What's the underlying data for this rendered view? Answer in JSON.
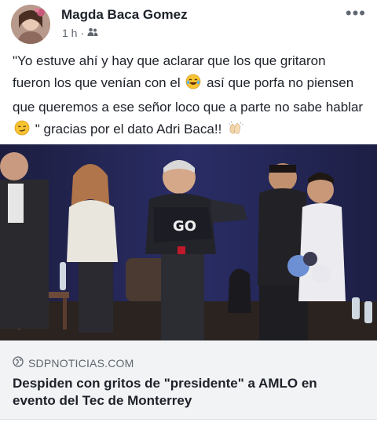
{
  "post": {
    "author": "Magda Baca Gomez",
    "time": "1 h",
    "separator": "·",
    "audience_icon": "friends-icon",
    "more_label": "•••",
    "text_part1": "\"Yo estuve ahí y hay que aclarar que los que gritaron fueron los que venían con el",
    "emoji1": "laughing-crying-emoji-icon",
    "text_part2": "así que porfa no piensen que queremos a ese señor loco que a parte no sabe hablar",
    "emoji2": "smirk-emoji-icon",
    "text_part3": "\" gracias por el dato Adri Baca!!",
    "emoji3": "clapping-hands-emoji-icon"
  },
  "link": {
    "source_icon": "globe-icon",
    "source": "SDPNOTICIAS.COM",
    "headline": "Despiden con gritos de \"presidente\" a AMLO en evento del Tec de Monterrey"
  },
  "colors": {
    "text": "#1d2129",
    "secondary": "#606770",
    "preview_bg": "#f2f3f5",
    "photo_bg": "#1a1d3a"
  }
}
